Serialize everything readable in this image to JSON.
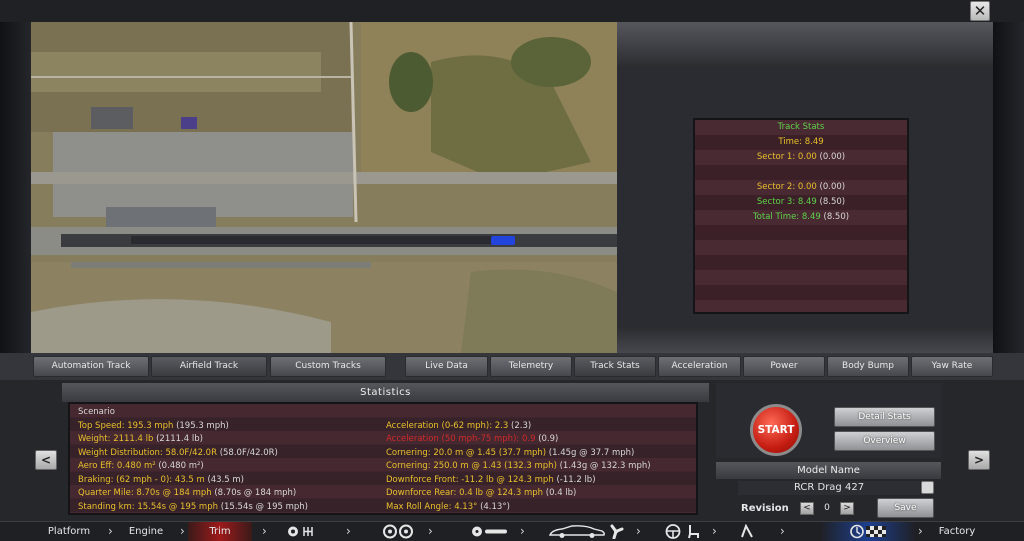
{
  "window": {
    "close_label": "✕"
  },
  "track_stats": {
    "title": "Track Stats",
    "time_label": "Time:",
    "time_value": "8.49",
    "sector1_label": "Sector 1:",
    "sector1_value": "0.00",
    "sector1_ref": "(0.00)",
    "sector2_label": "Sector 2:",
    "sector2_value": "0.00",
    "sector2_ref": "(0.00)",
    "sector3_label": "Sector 3:",
    "sector3_value": "8.49",
    "sector3_ref": "(8.50)",
    "total_label": "Total Time:",
    "total_value": "8.49",
    "total_ref": "(8.50)"
  },
  "tabs": {
    "track_tabs": [
      "Automation Track",
      "Airfield Track",
      "Custom Tracks"
    ],
    "view_tabs": [
      "Live Data",
      "Telemetry",
      "Track Stats",
      "Acceleration",
      "Power",
      "Body Bump",
      "Yaw Rate"
    ]
  },
  "statistics": {
    "header": "Statistics",
    "scenario": "Scenario",
    "left": [
      {
        "label": "Top Speed:",
        "value": "195.3 mph",
        "ref": "(195.3 mph)"
      },
      {
        "label": "Weight:",
        "value": "2111.4 lb",
        "ref": "(2111.4 lb)"
      },
      {
        "label": "Weight Distribution:",
        "value": "58.0F/42.0R",
        "ref": "(58.0F/42.0R)"
      },
      {
        "label": "Aero Eff:",
        "value": "0.480 m²",
        "ref": "(0.480 m²)"
      },
      {
        "label": "Braking: (62 mph - 0):",
        "value": "43.5 m",
        "ref": "(43.5 m)"
      },
      {
        "label": "Quarter Mile:",
        "value": "8.70s @ 184 mph",
        "ref": "(8.70s @ 184 mph)"
      },
      {
        "label": "Standing km:",
        "value": "15.54s @ 195 mph",
        "ref": "(15.54s @ 195 mph)"
      }
    ],
    "right": [
      {
        "label": "Acceleration (0-62 mph):",
        "value": "2.3",
        "ref": "(2.3)"
      },
      {
        "label": "Acceleration (50 mph-75 mph):",
        "value": "0.9",
        "ref": "(0.9)"
      },
      {
        "label": "Cornering:",
        "value": "20.0 m @ 1.45 (37.7 mph)",
        "ref": "(1.45g @ 37.7 mph)"
      },
      {
        "label": "Cornering:",
        "value": "250.0 m @ 1.43 (132.3 mph)",
        "ref": "(1.43g @ 132.3 mph)"
      },
      {
        "label": "Downforce Front:",
        "value": "-11.2 lb @ 124.3 mph",
        "ref": "(-11.2 lb)"
      },
      {
        "label": "Downforce Rear:",
        "value": "0.4 lb @ 124.3 mph",
        "ref": "(0.4 lb)"
      },
      {
        "label": "Max Roll Angle:",
        "value": "4.13°",
        "ref": "(4.13°)"
      }
    ]
  },
  "controls": {
    "start": "START",
    "detail_stats": "Detail Stats",
    "overview": "Overview",
    "model_name_header": "Model Name",
    "model_name": "RCR Drag 427",
    "revision_label": "Revision",
    "revision_value": "0",
    "save": "Save",
    "prev": "<",
    "next": ">"
  },
  "nav": {
    "platform": "Platform",
    "engine": "Engine",
    "trim": "Trim",
    "factory": "Factory"
  },
  "colors": {
    "accent_red": "#c51d12",
    "stat_yellow": "#e8c02a",
    "stat_green": "#5ed24a",
    "trim_red": "#9e1a1a"
  }
}
